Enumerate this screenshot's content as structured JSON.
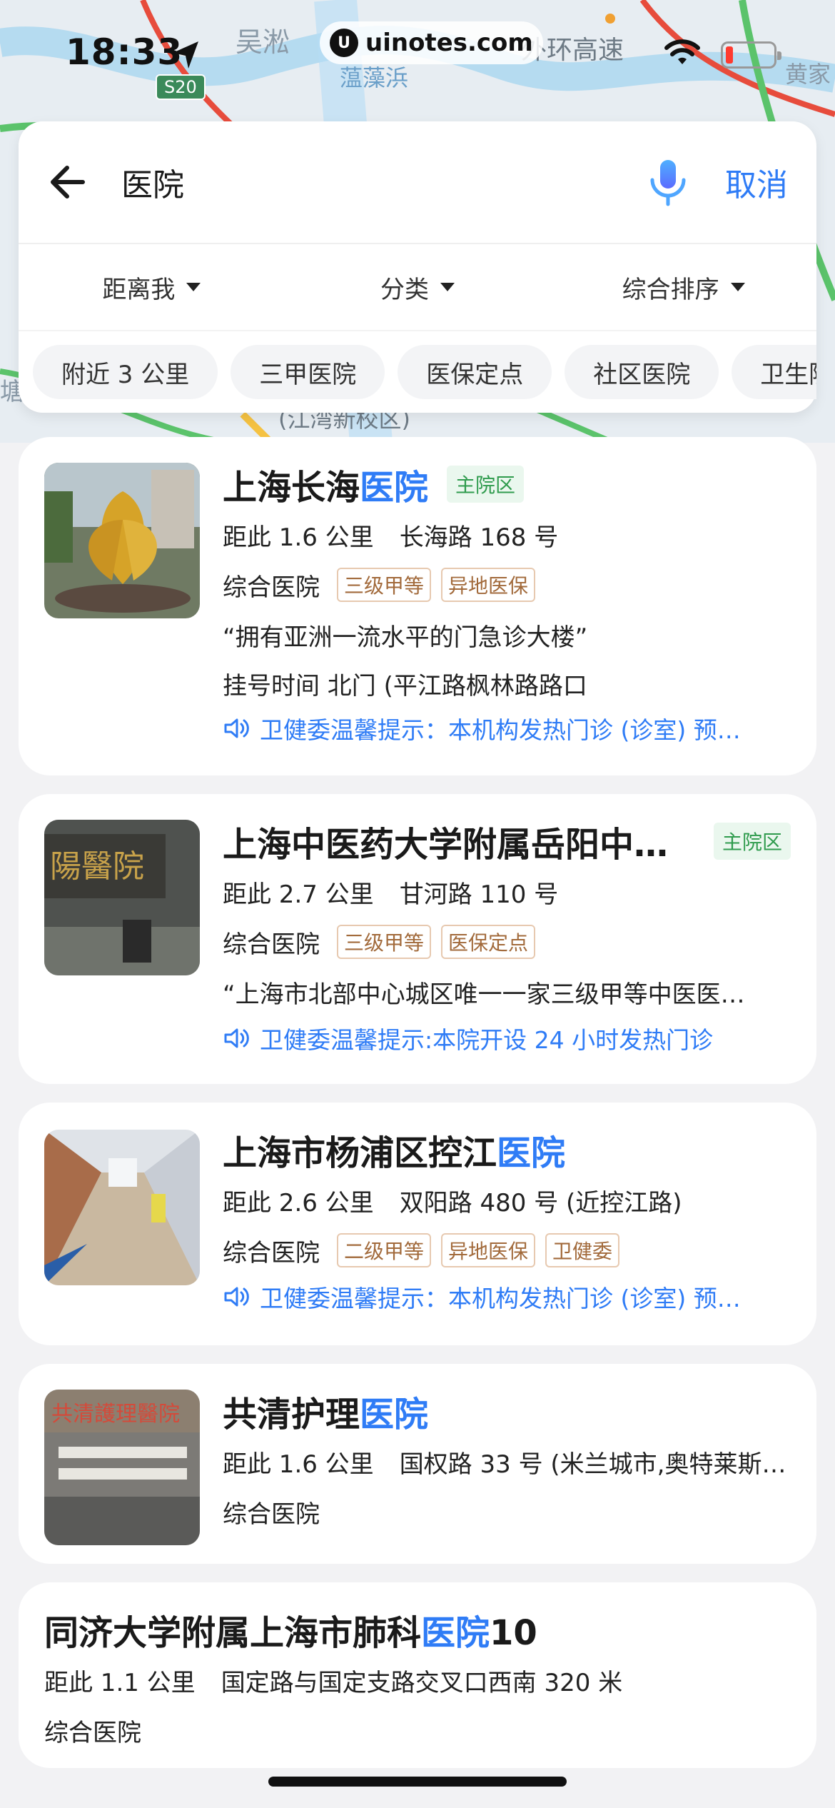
{
  "status_bar": {
    "time": "18:33",
    "highway_badge": "S20",
    "watermark": "uinotes.com"
  },
  "map": {
    "labels": [
      "吴淞",
      "外环高速",
      "黄家",
      "蕰藻浜",
      "(江湾新校区)",
      "塘"
    ]
  },
  "search": {
    "query": "医院",
    "cancel_label": "取消"
  },
  "filters": [
    {
      "label": "距离我"
    },
    {
      "label": "分类"
    },
    {
      "label": "综合排序"
    }
  ],
  "chips": [
    "附近 3 公里",
    "三甲医院",
    "医保定点",
    "社区医院",
    "卫生院"
  ],
  "results": [
    {
      "name_prefix": "上海长海",
      "name_highlight": "医院",
      "name_suffix": "",
      "branch": "主院区",
      "distance": "距此 1.6 公里",
      "address": "长海路 168 号",
      "category": "综合医院",
      "tags": [
        "三级甲等",
        "异地医保"
      ],
      "quote": "“拥有亚洲一流水平的门急诊大楼”",
      "hours": "挂号时间 北门 (平江路枫林路路口",
      "notice": "卫健委温馨提示：本机构发热门诊 (诊室) 预…"
    },
    {
      "name_prefix": "上海中医药大学附属岳阳中…",
      "name_highlight": "",
      "name_suffix": "",
      "branch": "主院区",
      "distance": "距此 2.7 公里",
      "address": "甘河路 110 号",
      "category": "综合医院",
      "tags": [
        "三级甲等",
        "医保定点"
      ],
      "quote": "“上海市北部中心城区唯一一家三级甲等中医医…",
      "notice": "卫健委温馨提示:本院开设 24 小时发热门诊"
    },
    {
      "name_prefix": "上海市杨浦区控江",
      "name_highlight": "医院",
      "name_suffix": "",
      "distance": "距此 2.6 公里",
      "address": "双阳路 480 号 (近控江路)",
      "category": "综合医院",
      "tags": [
        "二级甲等",
        "异地医保",
        "卫健委"
      ],
      "notice": "卫健委温馨提示：本机构发热门诊 (诊室) 预…"
    },
    {
      "name_prefix": "共清护理",
      "name_highlight": "医院",
      "name_suffix": "",
      "distance": "距此 1.6 公里",
      "address": "国权路 33 号 (米兰城市,奥特莱斯…",
      "category": "综合医院"
    },
    {
      "name_prefix": "同济大学附属上海市肺科",
      "name_highlight": "医院",
      "name_suffix": "10",
      "distance": "距此 1.1 公里",
      "address": "国定路与国定支路交叉口西南 320 米",
      "category": "综合医院"
    }
  ],
  "colors": {
    "accent": "#2f7cf6",
    "branch_green": "#2f9b4d",
    "tag_brown": "#a26a3b"
  }
}
